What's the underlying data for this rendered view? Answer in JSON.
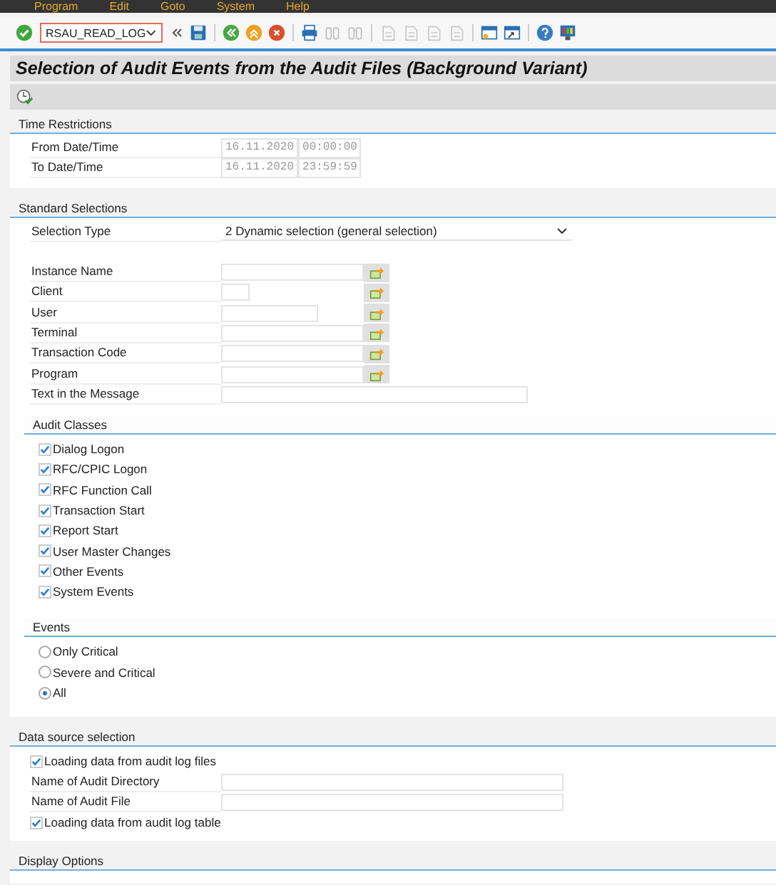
{
  "menu": [
    "Program",
    "Edit",
    "Goto",
    "System",
    "Help"
  ],
  "toolbar": {
    "command": "RSAU_READ_LOG"
  },
  "title": "Selection of Audit Events from the Audit Files (Background Variant)",
  "sections": [
    {
      "title": "Time Restrictions",
      "items": [
        {
          "kind": "datetime",
          "label": "From Date/Time",
          "date": "16.11.2020",
          "time": "00:00:00"
        },
        {
          "kind": "datetime",
          "label": "To Date/Time",
          "date": "16.11.2020",
          "time": "23:59:59"
        }
      ]
    },
    {
      "title": "Standard Selections",
      "items": [
        {
          "kind": "dropdown",
          "label": "Selection Type",
          "value": "2 Dynamic selection (general selection)"
        },
        {
          "kind": "field",
          "label": "Instance Name",
          "search_help": true
        },
        {
          "kind": "field",
          "label": "Client",
          "search_help": true
        },
        {
          "kind": "field",
          "label": "User",
          "search_help": true
        },
        {
          "kind": "field",
          "label": "Terminal",
          "search_help": true
        },
        {
          "kind": "field",
          "label": "Transaction Code",
          "search_help": true
        },
        {
          "kind": "field",
          "label": "Program",
          "search_help": true
        },
        {
          "kind": "field",
          "label": "Text in the Message",
          "search_help": false
        }
      ],
      "groups": [
        {
          "title": "Audit Classes",
          "items": [
            {
              "kind": "checkbox",
              "label": "Dialog Logon",
              "checked": true
            },
            {
              "kind": "checkbox",
              "label": "RFC/CPIC Logon",
              "checked": true
            },
            {
              "kind": "checkbox",
              "label": "RFC Function Call",
              "checked": true
            },
            {
              "kind": "checkbox",
              "label": "Transaction Start",
              "checked": true
            },
            {
              "kind": "checkbox",
              "label": "Report Start",
              "checked": true
            },
            {
              "kind": "checkbox",
              "label": "User Master Changes",
              "checked": true
            },
            {
              "kind": "checkbox",
              "label": "Other Events",
              "checked": true
            },
            {
              "kind": "checkbox",
              "label": "System Events",
              "checked": true
            }
          ]
        },
        {
          "title": "Events",
          "items": [
            {
              "kind": "radio",
              "label": "Only Critical",
              "selected": false
            },
            {
              "kind": "radio",
              "label": "Severe and Critical",
              "selected": false
            },
            {
              "kind": "radio",
              "label": "All",
              "selected": true
            }
          ]
        }
      ]
    },
    {
      "title": "Data source selection",
      "items": [
        {
          "kind": "checkbox",
          "label": "Loading data from audit log files",
          "checked": true
        },
        {
          "kind": "field",
          "label": "Name of Audit Directory",
          "search_help": false
        },
        {
          "kind": "field",
          "label": "Name of Audit File",
          "search_help": false
        },
        {
          "kind": "checkbox",
          "label": "Loading data from audit log table",
          "checked": true
        }
      ]
    },
    {
      "title": "Display Options"
    }
  ]
}
